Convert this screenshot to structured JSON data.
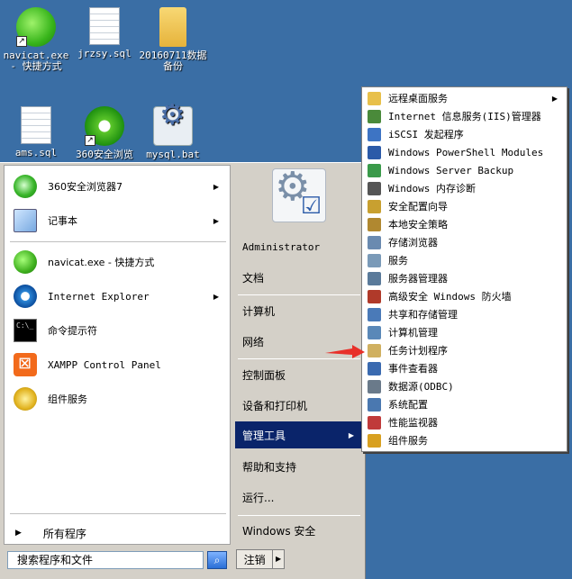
{
  "desktop": {
    "icons": [
      {
        "name": "navicat-shortcut",
        "label": "navicat.exe\n- 快捷方式",
        "icon": "navicat-icon"
      },
      {
        "name": "jrzsy-sql",
        "label": "jrzsy.sql",
        "icon": "file-icon"
      },
      {
        "name": "backup-folder",
        "label": "20160711数据\n备份",
        "icon": "folder-icon"
      },
      {
        "name": "ams-sql",
        "label": "ams.sql",
        "icon": "file-icon"
      },
      {
        "name": "browser-360",
        "label": "360安全浏览",
        "icon": "ie-icon"
      },
      {
        "name": "mysql-bat",
        "label": "mysql.bat",
        "icon": "gear-icon"
      }
    ]
  },
  "start_menu": {
    "pinned": [
      {
        "label": "360安全浏览器7",
        "icon": "browser-360-icon",
        "has_submenu": true
      },
      {
        "label": "记事本",
        "icon": "notepad-icon",
        "has_submenu": true
      }
    ],
    "recent": [
      {
        "label": "navicat.exe - 快捷方式",
        "icon": "navicat-icon",
        "has_submenu": false
      },
      {
        "label": "Internet Explorer",
        "icon": "ie-icon",
        "has_submenu": true
      },
      {
        "label": "命令提示符",
        "icon": "cmd-icon",
        "has_submenu": false
      },
      {
        "label": "XAMPP Control Panel",
        "icon": "xampp-icon",
        "has_submenu": false
      },
      {
        "label": "组件服务",
        "icon": "component-services-icon",
        "has_submenu": false
      }
    ],
    "all_programs": "所有程序",
    "search_placeholder": "搜索程序和文件",
    "right": {
      "user": "Administrator",
      "documents": "文档",
      "computer": "计算机",
      "network": "网络",
      "control_panel": "控制面板",
      "devices": "设备和打印机",
      "admin_tools": "管理工具",
      "help": "帮助和支持",
      "run": "运行...",
      "security": "Windows 安全"
    },
    "logoff": "注销"
  },
  "admin_tools_menu": {
    "items": [
      {
        "label": "远程桌面服务",
        "icon": "folder-icon",
        "color": "#e8c04a",
        "has_submenu": true
      },
      {
        "label": "Internet 信息服务(IIS)管理器",
        "icon": "iis-icon",
        "color": "#4a8a3a",
        "has_submenu": false
      },
      {
        "label": "iSCSI 发起程序",
        "icon": "iscsi-icon",
        "color": "#3d74c4",
        "has_submenu": false
      },
      {
        "label": "Windows PowerShell Modules",
        "icon": "powershell-icon",
        "color": "#2b5aa8",
        "has_submenu": false
      },
      {
        "label": "Windows Server Backup",
        "icon": "backup-icon",
        "color": "#3a9a4a",
        "has_submenu": false
      },
      {
        "label": "Windows 内存诊断",
        "icon": "memory-icon",
        "color": "#555555",
        "has_submenu": false
      },
      {
        "label": "安全配置向导",
        "icon": "security-wizard-icon",
        "color": "#c8a030",
        "has_submenu": false
      },
      {
        "label": "本地安全策略",
        "icon": "local-policy-icon",
        "color": "#b08830",
        "has_submenu": false
      },
      {
        "label": "存储浏览器",
        "icon": "storage-icon",
        "color": "#6a8ab0",
        "has_submenu": false
      },
      {
        "label": "服务",
        "icon": "services-icon",
        "color": "#7a9ab8",
        "has_submenu": false
      },
      {
        "label": "服务器管理器",
        "icon": "server-manager-icon",
        "color": "#5a7a9a",
        "has_submenu": false
      },
      {
        "label": "高级安全 Windows 防火墙",
        "icon": "firewall-icon",
        "color": "#b03a2a",
        "has_submenu": false
      },
      {
        "label": "共享和存储管理",
        "icon": "share-icon",
        "color": "#4a7ab8",
        "has_submenu": false
      },
      {
        "label": "计算机管理",
        "icon": "computer-management-icon",
        "color": "#5a88b8",
        "has_submenu": false
      },
      {
        "label": "任务计划程序",
        "icon": "task-scheduler-icon",
        "color": "#d0b060",
        "has_submenu": false
      },
      {
        "label": "事件查看器",
        "icon": "event-viewer-icon",
        "color": "#3a6ab0",
        "has_submenu": false
      },
      {
        "label": "数据源(ODBC)",
        "icon": "odbc-icon",
        "color": "#6a7a8a",
        "has_submenu": false
      },
      {
        "label": "系统配置",
        "icon": "system-config-icon",
        "color": "#4a78b0",
        "has_submenu": false
      },
      {
        "label": "性能监视器",
        "icon": "performance-icon",
        "color": "#c03a3a",
        "has_submenu": false
      },
      {
        "label": "组件服务",
        "icon": "component-services-icon",
        "color": "#d8a020",
        "has_submenu": false
      }
    ]
  }
}
